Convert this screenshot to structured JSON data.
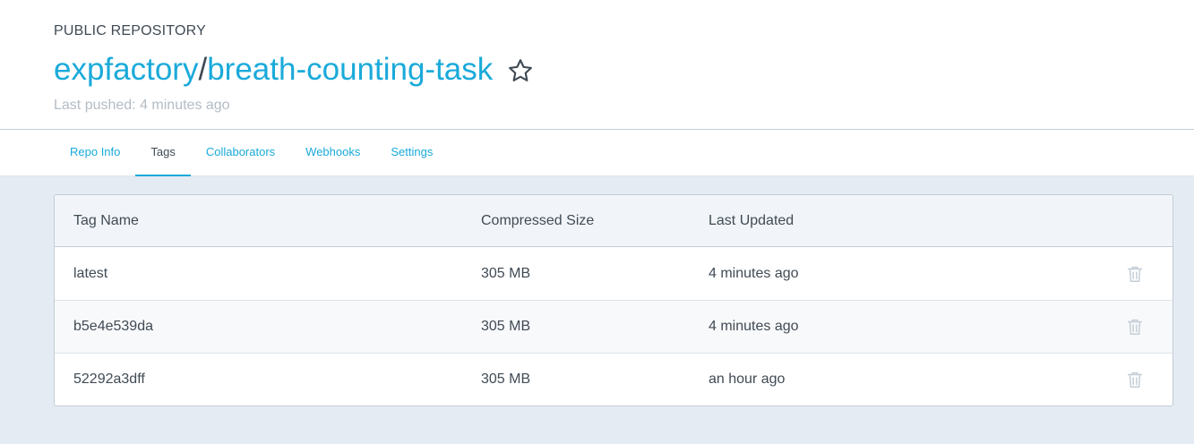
{
  "header": {
    "visibility": "PUBLIC REPOSITORY",
    "namespace": "expfactory",
    "separator": "/",
    "repo_name": "breath-counting-task",
    "last_pushed": "Last pushed: 4 minutes ago",
    "star_icon": "star-outline-icon"
  },
  "tabs": [
    {
      "label": "Repo Info",
      "active": false
    },
    {
      "label": "Tags",
      "active": true
    },
    {
      "label": "Collaborators",
      "active": false
    },
    {
      "label": "Webhooks",
      "active": false
    },
    {
      "label": "Settings",
      "active": false
    }
  ],
  "table": {
    "columns": [
      "Tag Name",
      "Compressed Size",
      "Last Updated"
    ],
    "rows": [
      {
        "name": "latest",
        "size": "305 MB",
        "updated": "4 minutes ago"
      },
      {
        "name": "b5e4e539da",
        "size": "305 MB",
        "updated": "4 minutes ago"
      },
      {
        "name": "52292a3dff",
        "size": "305 MB",
        "updated": "an hour ago"
      }
    ],
    "row_action_icon": "trash-icon"
  },
  "colors": {
    "accent": "#1aaada",
    "text": "#404a54",
    "muted": "#b4bcc5",
    "content_bg": "#e4ebf2",
    "icon_muted": "#c4cdd6"
  }
}
